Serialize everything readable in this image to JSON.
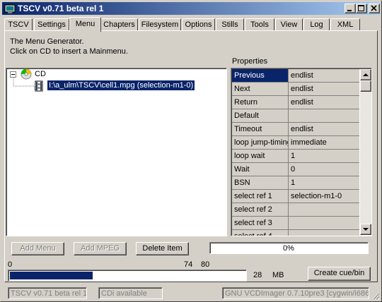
{
  "window": {
    "title": "TSCV v0.71 beta rel 1",
    "buttons": [
      "minimize",
      "maximize",
      "close"
    ]
  },
  "tabs": [
    {
      "label": "TSCV"
    },
    {
      "label": "Settings"
    },
    {
      "label": "Menu",
      "active": true
    },
    {
      "label": "Chapters"
    },
    {
      "label": "Filesystem"
    },
    {
      "label": "Options"
    },
    {
      "label": "Stills"
    },
    {
      "label": "Tools"
    },
    {
      "label": "View"
    },
    {
      "label": "Log"
    },
    {
      "label": "XML"
    }
  ],
  "menu": {
    "intro_line1": "The Menu Generator.",
    "intro_line2": "Click on CD to insert a Mainmenu.",
    "tree": {
      "root_label": "CD",
      "child_label": "I:\\a_ulm\\TSCV\\cell1.mpg (selection-m1-0)"
    },
    "properties_title": "Properties",
    "properties": [
      {
        "key": "Previous",
        "value": "endlist"
      },
      {
        "key": "Next",
        "value": "endlist"
      },
      {
        "key": "Return",
        "value": "endlist"
      },
      {
        "key": "Default",
        "value": ""
      },
      {
        "key": "Timeout",
        "value": "endlist"
      },
      {
        "key": "loop jump-timing",
        "value": "immediate"
      },
      {
        "key": "loop wait",
        "value": "1"
      },
      {
        "key": "Wait",
        "value": "0"
      },
      {
        "key": "BSN",
        "value": "1"
      },
      {
        "key": "select ref 1",
        "value": "selection-m1-0"
      },
      {
        "key": "select ref 2",
        "value": ""
      },
      {
        "key": "select ref 3",
        "value": ""
      },
      {
        "key": "select ref 4",
        "value": ""
      }
    ],
    "add_menu_label": "Add Menu",
    "add_mpeg_label": "Add MPEG",
    "delete_item_label": "Delete Item",
    "progress_text": "0%",
    "progress_value": 0
  },
  "size_bar": {
    "label_zero": "0",
    "label_74": "74",
    "label_80": "80",
    "value": "28",
    "unit": "MB",
    "fill_fraction": 0.35
  },
  "create_cue_label": "Create cue/bin",
  "statusbar": {
    "left": "TSCV v0.71 beta rel 1",
    "middle": "CDi available",
    "right": "GNU VCDImager 0.7.10pre3 [cygwin/i686]"
  },
  "colors": {
    "face": "#d4d0c8",
    "selection": "#0a246a",
    "title_gradient_end": "#a6caf0",
    "progress_fill": "#0a246a"
  }
}
